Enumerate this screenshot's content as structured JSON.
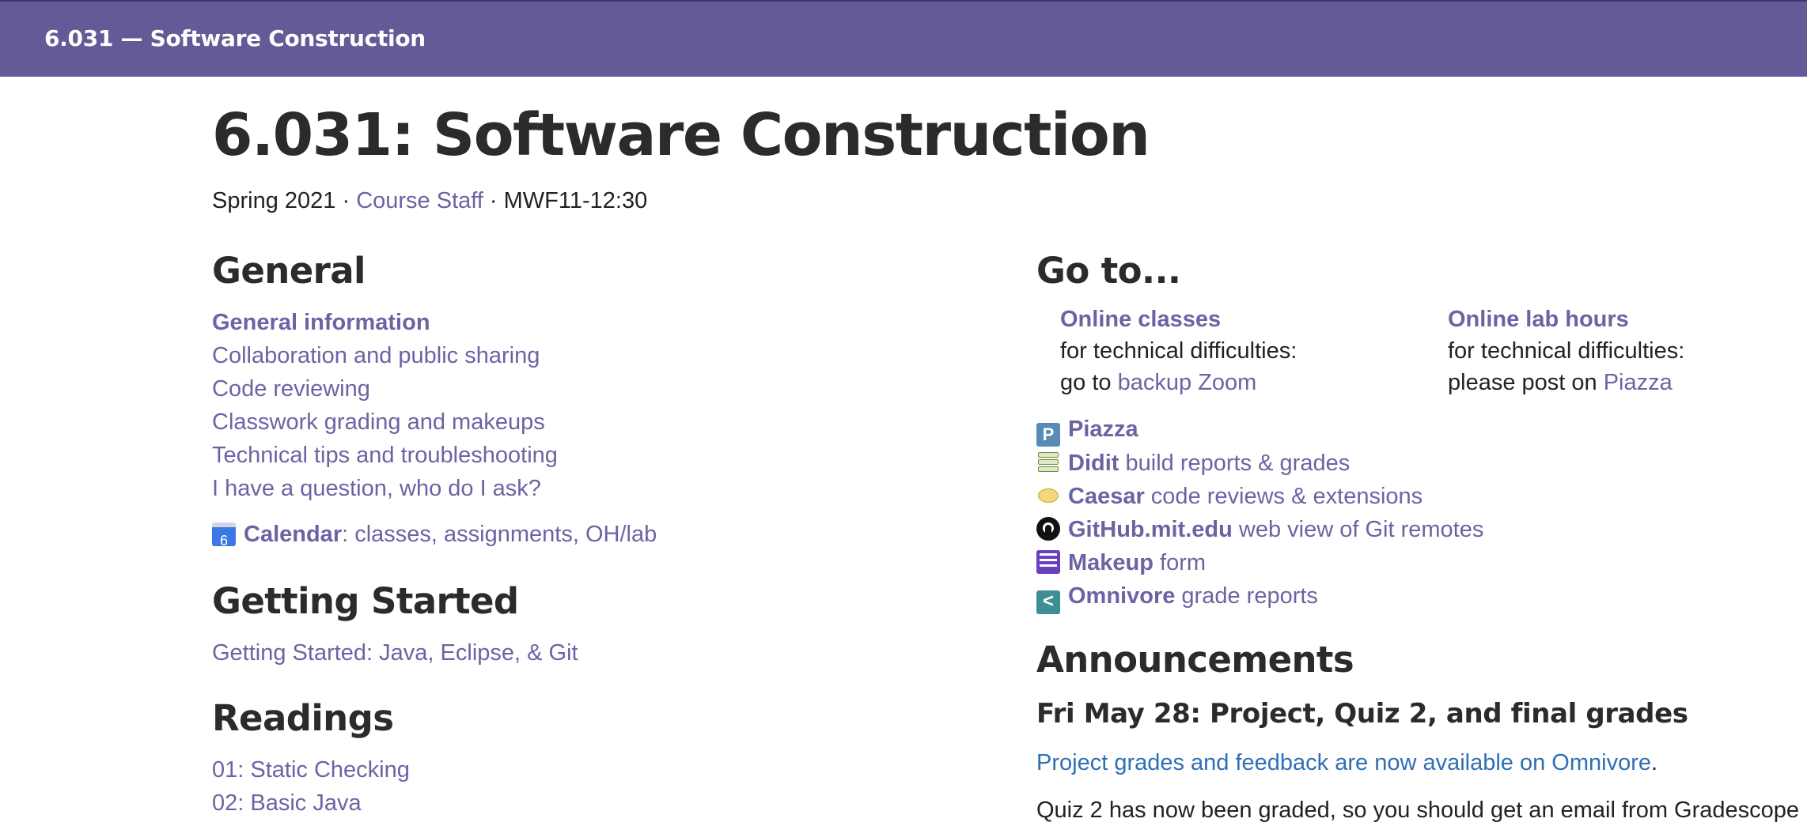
{
  "topbar": {
    "brand": "6.031 — Software Construction"
  },
  "page": {
    "title": "6.031: Software Construction",
    "term": "Spring 2021",
    "sep1": " · ",
    "staff_link": "Course Staff",
    "sep2": " · ",
    "schedule": "MWF11-12:30"
  },
  "general": {
    "heading": "General",
    "links": [
      "General information",
      "Collaboration and public sharing",
      "Code reviewing",
      "Classwork grading and makeups",
      "Technical tips and troubleshooting",
      "I have a question, who do I ask?"
    ],
    "calendar": {
      "icon_label": "6",
      "label": "Calendar",
      "text": ": classes, assignments, OH/lab"
    }
  },
  "getting_started": {
    "heading": "Getting Started",
    "link": "Getting Started: Java, Eclipse, & Git"
  },
  "readings": {
    "heading": "Readings",
    "items": [
      "01: Static Checking",
      "02: Basic Java"
    ]
  },
  "goto": {
    "heading": "Go to...",
    "online_classes": {
      "head": "Online classes",
      "line1": "for technical difficulties:",
      "line2_prefix": "go to ",
      "line2_link": "backup Zoom"
    },
    "online_lab": {
      "head": "Online lab hours",
      "line1": "for technical difficulties:",
      "line2_prefix": "please post on ",
      "line2_link": "Piazza"
    },
    "tools": [
      {
        "icon": "piazza-icon",
        "name": "Piazza",
        "desc": ""
      },
      {
        "icon": "didit-icon",
        "name": "Didit",
        "desc": " build reports & grades"
      },
      {
        "icon": "caesar-icon",
        "name": "Caesar",
        "desc": " code reviews & extensions"
      },
      {
        "icon": "github-icon",
        "name": "GitHub.mit.edu",
        "desc": " web view of Git remotes"
      },
      {
        "icon": "makeup-form-icon",
        "name": "Makeup",
        "desc": " form"
      },
      {
        "icon": "omnivore-icon",
        "name": "Omnivore",
        "desc": " grade reports"
      }
    ],
    "piazza_icon_glyph": "P",
    "omnivore_icon_glyph": "<"
  },
  "announcements": {
    "heading": "Announcements",
    "entry_title": "Fri May 28: Project, Quiz 2, and final grades",
    "link": "Project grades and feedback are now available on Omnivore",
    "link_suffix": ".",
    "text": "Quiz 2 has now been graded, so you should get an email from Gradescope"
  },
  "colors": {
    "topbar": "#625b97",
    "link": "#6a64a4",
    "announcement_link": "#2f6fb5"
  }
}
